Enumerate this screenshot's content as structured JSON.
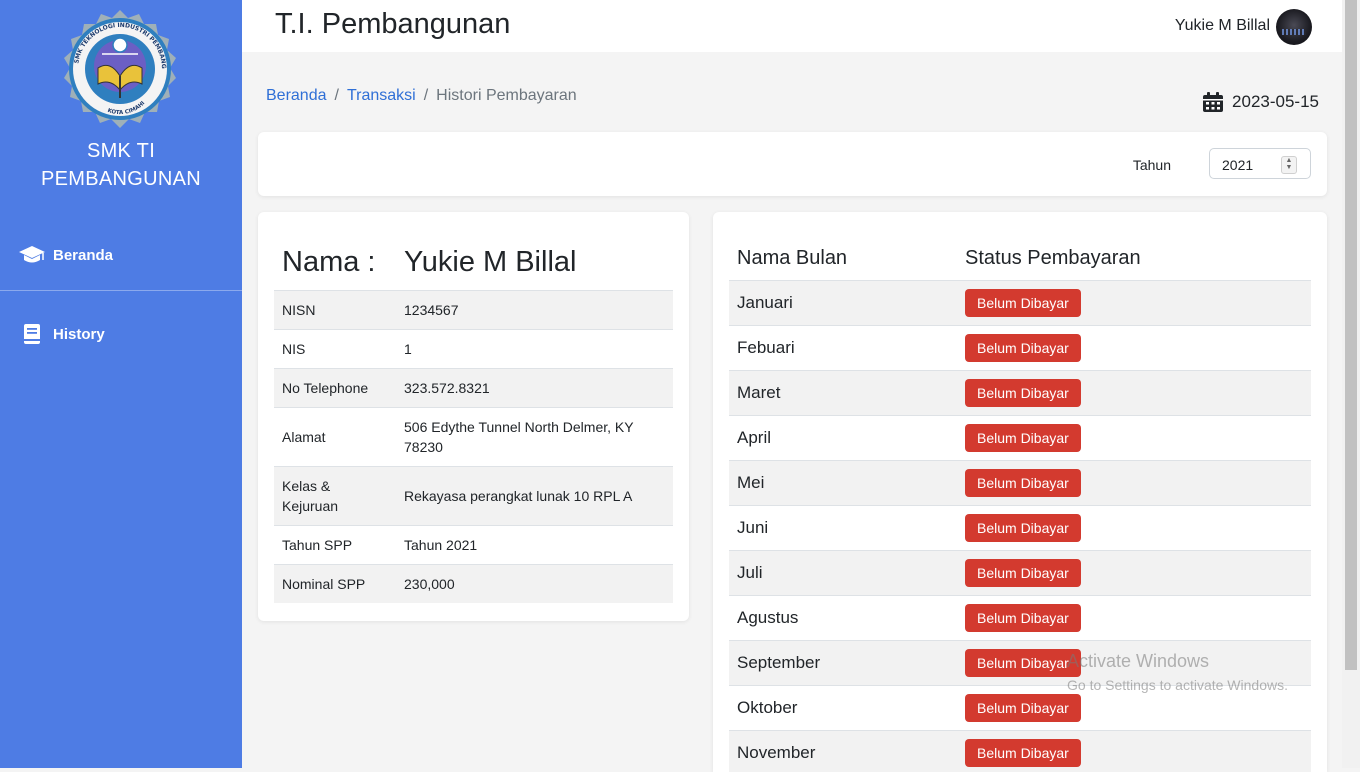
{
  "sidebar": {
    "logo_text": "SMK TEKNOLOGI INDUSTRI PEMBANGUNAN · KOTA CIMAHI",
    "school_line1": "SMK TI",
    "school_line2": "PEMBANGUNAN",
    "items": [
      {
        "label": "Beranda",
        "icon": "graduation-cap-icon"
      },
      {
        "label": "History",
        "icon": "book-icon"
      }
    ]
  },
  "header": {
    "title": "T.I. Pembangunan",
    "user_name": "Yukie M Billal"
  },
  "breadcrumb": {
    "items": [
      "Beranda",
      "Transaksi",
      "Histori Pembayaran"
    ],
    "separator": "/"
  },
  "date": "2023-05-15",
  "filter": {
    "label": "Tahun",
    "value": "2021"
  },
  "profile": {
    "name_label": "Nama :",
    "name_value": "Yukie M Billal",
    "rows": [
      {
        "key": "NISN",
        "value": "1234567"
      },
      {
        "key": "NIS",
        "value": "1"
      },
      {
        "key": "No Telephone",
        "value": "323.572.8321"
      },
      {
        "key": "Alamat",
        "value": "506 Edythe Tunnel North Delmer, KY 78230"
      },
      {
        "key": "Kelas & Kejuruan",
        "value": "Rekayasa perangkat lunak 10 RPL A"
      },
      {
        "key": "Tahun SPP",
        "value": "Tahun 2021"
      },
      {
        "key": "Nominal SPP",
        "value": "230,000"
      }
    ]
  },
  "payments": {
    "col_month": "Nama Bulan",
    "col_status": "Status Pembayaran",
    "rows": [
      {
        "month": "Januari",
        "status": "Belum Dibayar"
      },
      {
        "month": "Febuari",
        "status": "Belum Dibayar"
      },
      {
        "month": "Maret",
        "status": "Belum Dibayar"
      },
      {
        "month": "April",
        "status": "Belum Dibayar"
      },
      {
        "month": "Mei",
        "status": "Belum Dibayar"
      },
      {
        "month": "Juni",
        "status": "Belum Dibayar"
      },
      {
        "month": "Juli",
        "status": "Belum Dibayar"
      },
      {
        "month": "Agustus",
        "status": "Belum Dibayar"
      },
      {
        "month": "September",
        "status": "Belum Dibayar"
      },
      {
        "month": "Oktober",
        "status": "Belum Dibayar"
      },
      {
        "month": "November",
        "status": "Belum Dibayar"
      }
    ]
  },
  "watermark": {
    "line1": "Activate Windows",
    "line2": "Go to Settings to activate Windows."
  },
  "colors": {
    "sidebar": "#4e7ce4",
    "badge_unpaid": "#d33a2f",
    "link": "#2f6fd6"
  }
}
